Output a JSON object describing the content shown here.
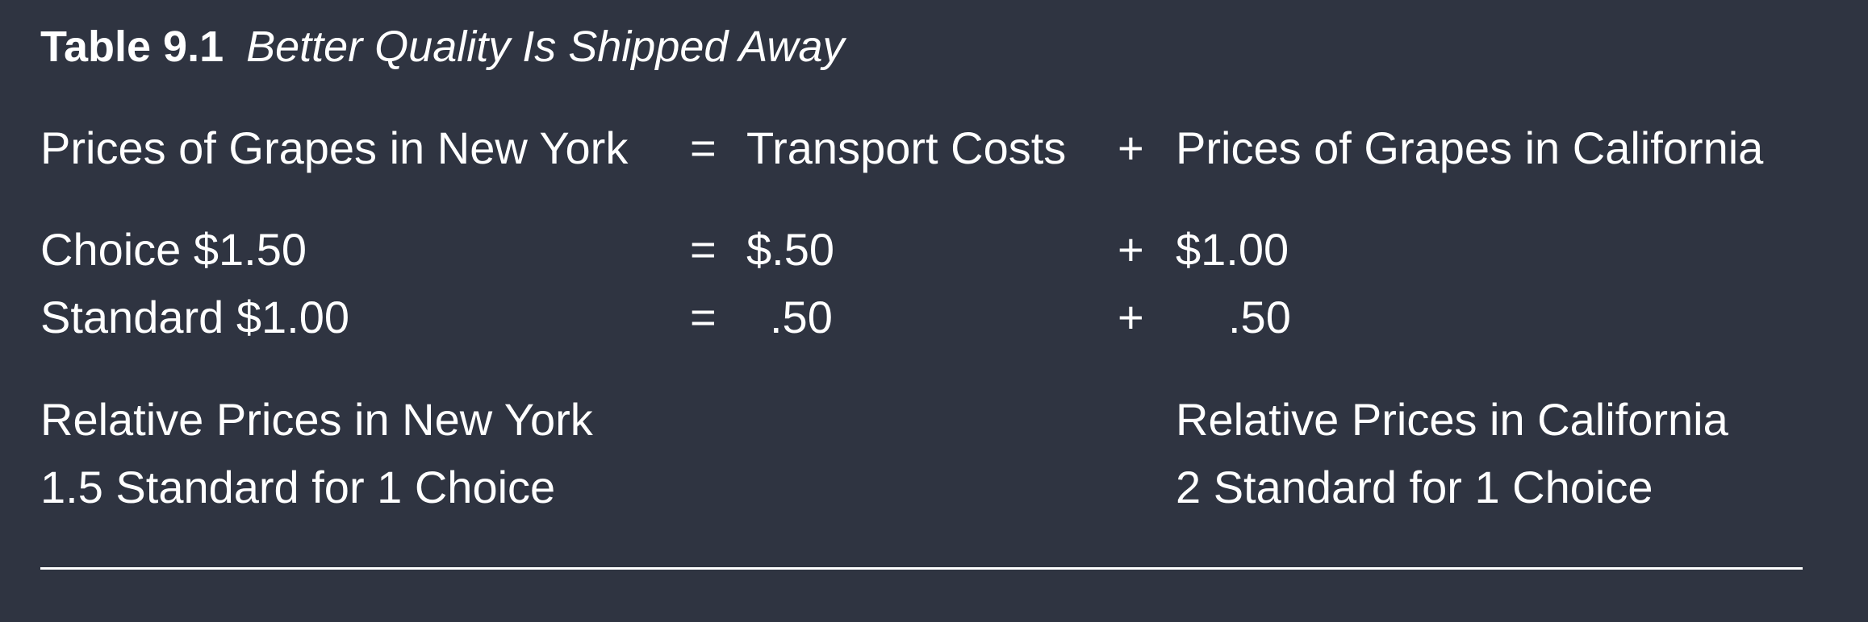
{
  "caption": {
    "label": "Table 9.1",
    "title": "Better Quality Is Shipped Away"
  },
  "header": {
    "ny_price": "Prices of Grapes in New York",
    "equals": "=",
    "transport": "Transport Costs",
    "plus": "+",
    "ca_price": "Prices of Grapes in California"
  },
  "rows": [
    {
      "ny": "Choice $1.50",
      "equals": "=",
      "transport": "$.50",
      "plus": "+",
      "ca": "$1.00"
    },
    {
      "ny": "Standard $1.00",
      "equals": "=",
      "transport": ".50",
      "plus": "+",
      "ca": ".50"
    }
  ],
  "relative": {
    "ny_heading": "Relative Prices in New York",
    "ny_value": "1.5 Standard for 1 Choice",
    "ca_heading": "Relative Prices in California",
    "ca_value": "2 Standard for 1 Choice"
  },
  "colors": {
    "background": "#2f3441",
    "text": "#ffffff"
  }
}
